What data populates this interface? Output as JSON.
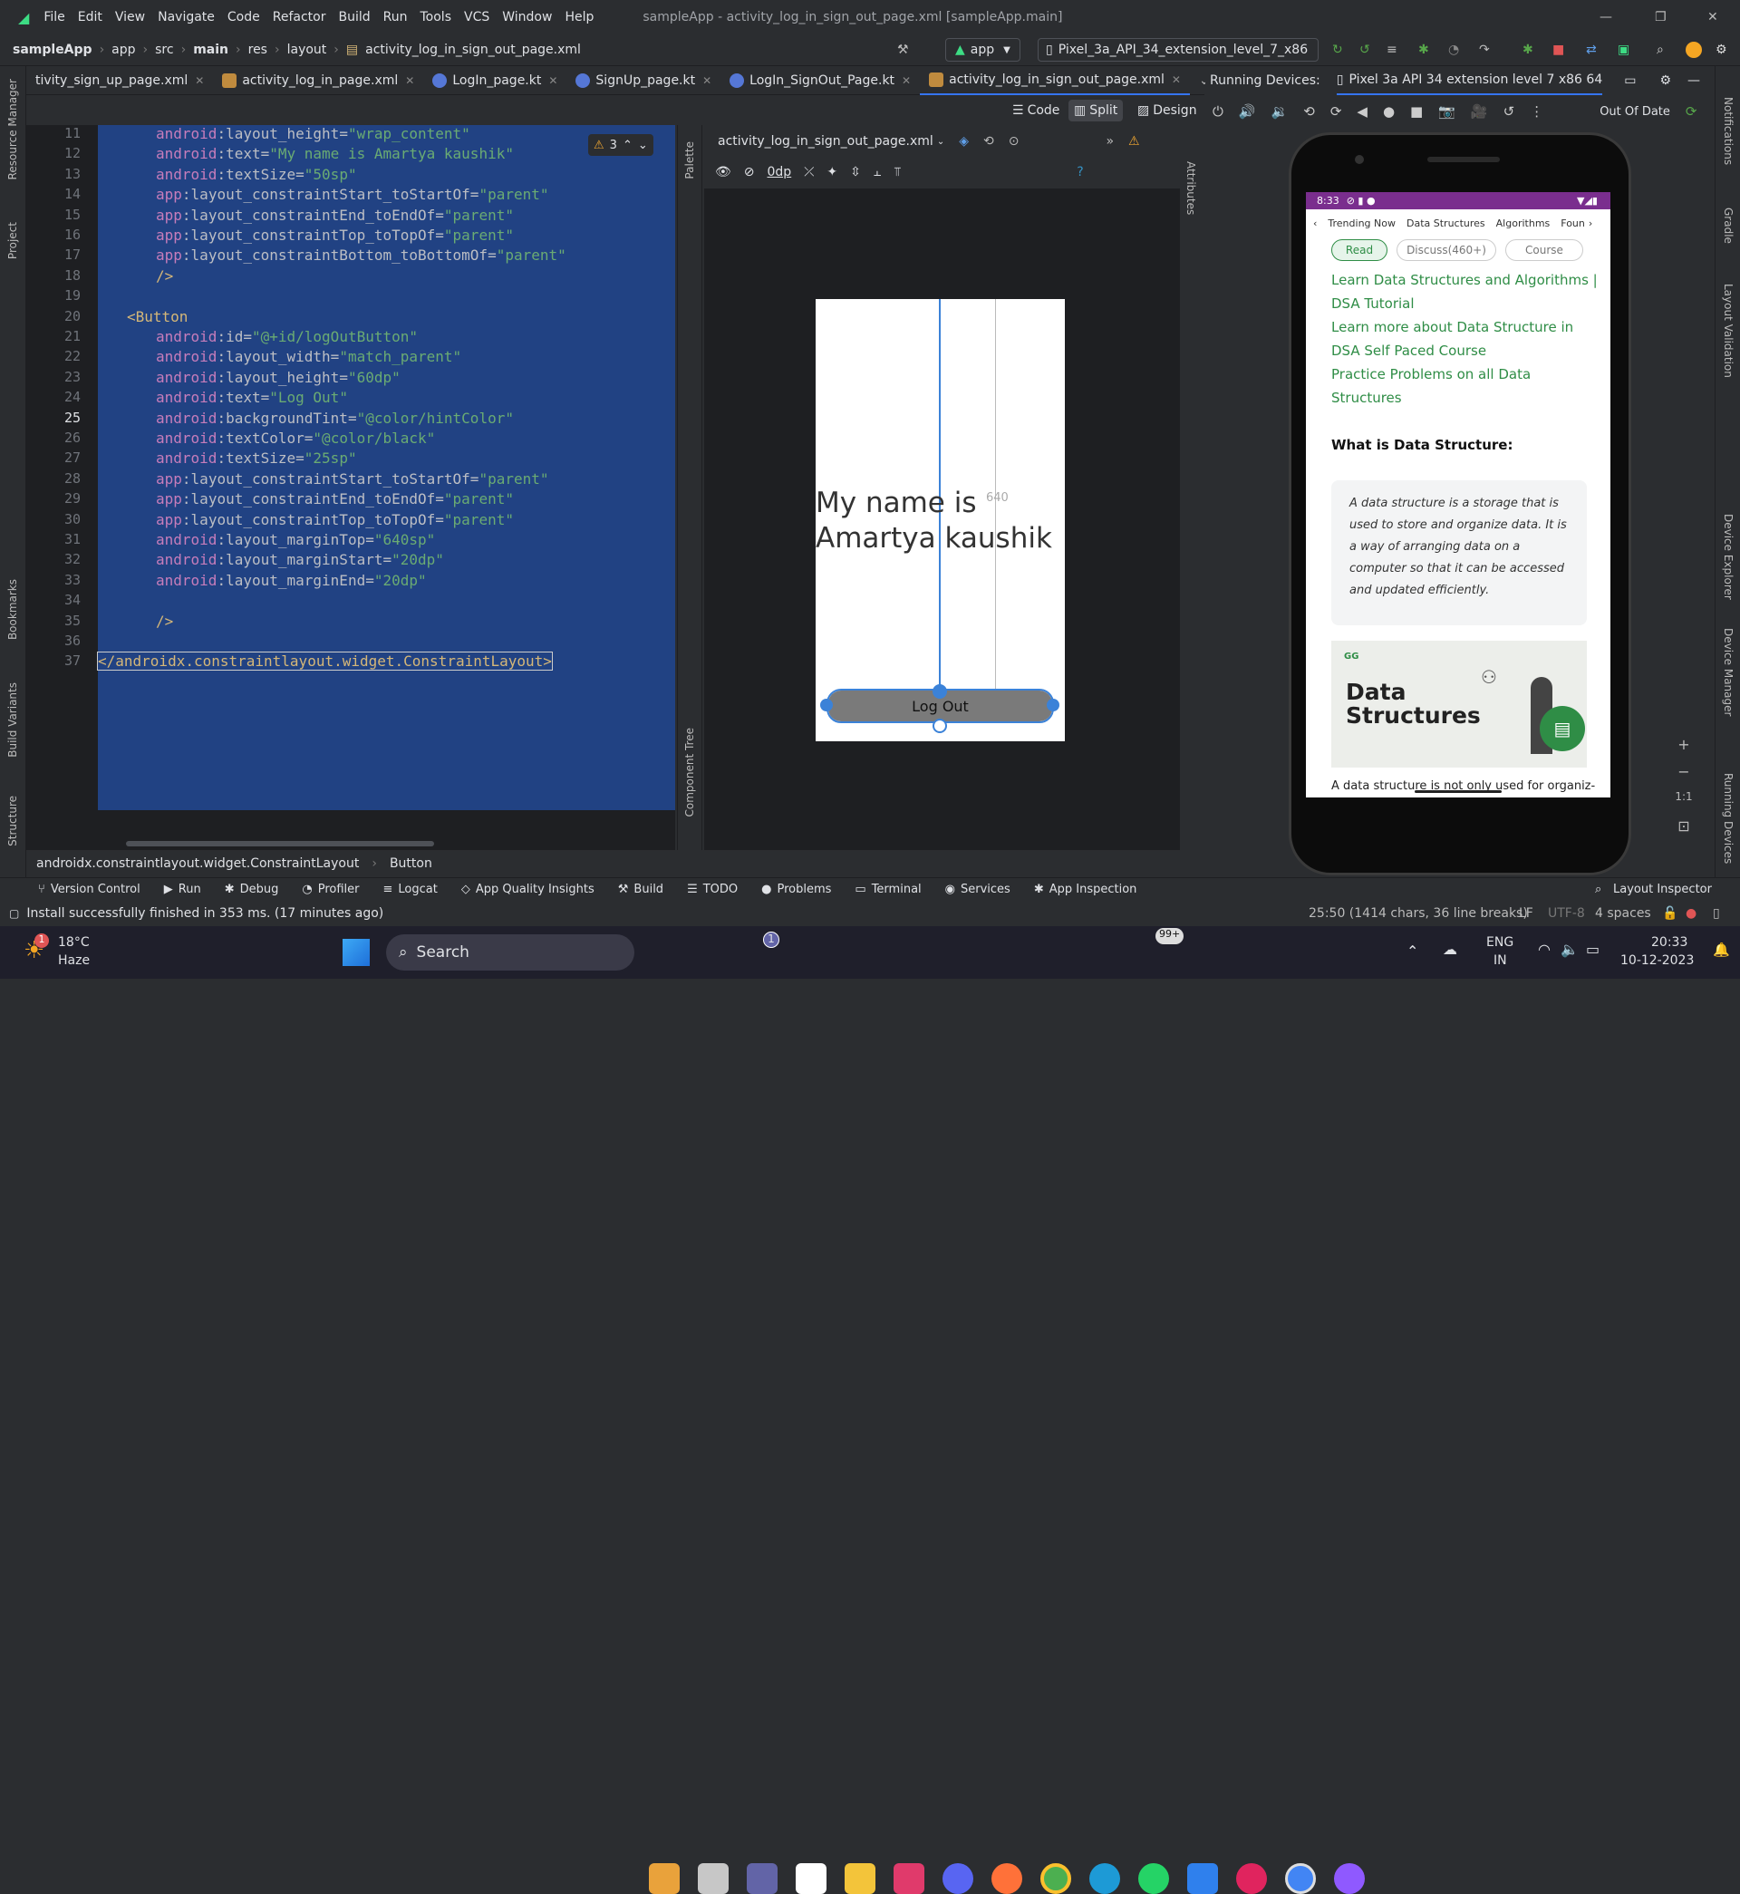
{
  "menu": {
    "items": [
      "File",
      "Edit",
      "View",
      "Navigate",
      "Code",
      "Refactor",
      "Build",
      "Run",
      "Tools",
      "VCS",
      "Window",
      "Help"
    ],
    "window_title": "sampleApp - activity_log_in_sign_out_page.xml [sampleApp.main]"
  },
  "breadcrumb": {
    "items": [
      "sampleApp",
      "app",
      "src",
      "main",
      "res",
      "layout",
      "activity_log_in_sign_out_page.xml"
    ]
  },
  "toolbar": {
    "run_config": "app",
    "device": "Pixel_3a_API_34_extension_level_7_x86"
  },
  "tabs": [
    {
      "label": "tivity_sign_up_page.xml"
    },
    {
      "label": "activity_log_in_page.xml"
    },
    {
      "label": "LogIn_page.kt"
    },
    {
      "label": "SignUp_page.kt"
    },
    {
      "label": "LogIn_SignOut_Page.kt"
    },
    {
      "label": "activity_log_in_sign_out_page.xml"
    }
  ],
  "running_devices": {
    "label": "Running Devices:",
    "device_tab": "Pixel 3a API 34 extension level 7 x86 64",
    "status": "Out Of Date"
  },
  "view_modes": {
    "code": "Code",
    "split": "Split",
    "design": "Design"
  },
  "editor": {
    "warning_count": "3",
    "line_numbers": [
      "11",
      "12",
      "13",
      "14",
      "15",
      "16",
      "17",
      "18",
      "19",
      "20",
      "21",
      "22",
      "23",
      "24",
      "25",
      "26",
      "27",
      "28",
      "29",
      "30",
      "31",
      "32",
      "33",
      "34",
      "35",
      "36",
      "37"
    ],
    "lines": [
      {
        "ns": "android",
        "attr": "layout_height",
        "val": "\"wrap_content\""
      },
      {
        "ns": "android",
        "attr": "text",
        "val": "\"My name is Amartya kaushik\""
      },
      {
        "ns": "android",
        "attr": "textSize",
        "val": "\"50sp\""
      },
      {
        "ns": "app",
        "attr": "layout_constraintStart_toStartOf",
        "val": "\"parent\""
      },
      {
        "ns": "app",
        "attr": "layout_constraintEnd_toEndOf",
        "val": "\"parent\""
      },
      {
        "ns": "app",
        "attr": "layout_constraintTop_toTopOf",
        "val": "\"parent\""
      },
      {
        "ns": "app",
        "attr": "layout_constraintBottom_toBottomOf",
        "val": "\"parent\""
      },
      {
        "tag": "/>"
      },
      {
        "tag": ""
      },
      {
        "tag": "<Button"
      },
      {
        "ns": "android",
        "attr": "id",
        "val": "\"@+id/logOutButton\""
      },
      {
        "ns": "android",
        "attr": "layout_width",
        "val": "\"match_parent\""
      },
      {
        "ns": "android",
        "attr": "layout_height",
        "val": "\"60dp\""
      },
      {
        "ns": "android",
        "attr": "text",
        "val": "\"Log Out\""
      },
      {
        "ns": "android",
        "attr": "backgroundTint",
        "val": "\"@color/hintColor\""
      },
      {
        "ns": "android",
        "attr": "textColor",
        "val": "\"@color/black\""
      },
      {
        "ns": "android",
        "attr": "textSize",
        "val": "\"25sp\""
      },
      {
        "ns": "app",
        "attr": "layout_constraintStart_toStartOf",
        "val": "\"parent\""
      },
      {
        "ns": "app",
        "attr": "layout_constraintEnd_toEndOf",
        "val": "\"parent\""
      },
      {
        "ns": "app",
        "attr": "layout_constraintTop_toTopOf",
        "val": "\"parent\""
      },
      {
        "ns": "android",
        "attr": "layout_marginTop",
        "val": "\"640sp\""
      },
      {
        "ns": "android",
        "attr": "layout_marginStart",
        "val": "\"20dp\""
      },
      {
        "ns": "android",
        "attr": "layout_marginEnd",
        "val": "\"20dp\""
      },
      {
        "tag": ""
      },
      {
        "tag": "/>"
      },
      {
        "tag": ""
      },
      {
        "tag": "</androidx.constraintlayout.widget.ConstraintLayout>"
      }
    ],
    "footer_breadcrumb": [
      "androidx.constraintlayout.widget.ConstraintLayout",
      "Button"
    ]
  },
  "design": {
    "file": "activity_log_in_sign_out_page.xml",
    "margin_value": "0dp",
    "preview_text": "My name is Amartya kaushik",
    "button_label": "Log Out",
    "dimension_label": "640",
    "palette": "Palette",
    "component_tree": "Component Tree",
    "attributes": "Attributes"
  },
  "device_screen": {
    "time": "8:33",
    "nav_tabs": [
      "Trending Now",
      "Data Structures",
      "Algorithms",
      "Foun"
    ],
    "chips": [
      "Read",
      "Discuss(460+)",
      "Course"
    ],
    "links": [
      "Learn Data Structures and Algorithms | DSA Tutorial",
      "Learn more about Data Structure in DSA Self Paced Course",
      "Practice Problems on all Data Structures"
    ],
    "heading": "What is Data Structure:",
    "quote": "A data structure is a storage that is used to store and organize data. It is a way of arranging data on a computer so that it can be accessed and updated efficiently.",
    "banner_logo": "GG",
    "banner_title": "Data Structures",
    "trailing_text": "A data structure is not only used for organiz-"
  },
  "device_zoom": {
    "ratio": "1:1"
  },
  "side_labels": {
    "left": [
      "Resource Manager",
      "Project",
      "Bookmarks",
      "Build Variants",
      "Structure"
    ],
    "right": [
      "Notifications",
      "Gradle",
      "Layout Validation",
      "Device Explorer",
      "Device Manager",
      "Running Devices"
    ]
  },
  "bottom_tools": [
    "Version Control",
    "Run",
    "Debug",
    "Profiler",
    "Logcat",
    "App Quality Insights",
    "Build",
    "TODO",
    "Problems",
    "Terminal",
    "Services",
    "App Inspection"
  ],
  "layout_inspector": "Layout Inspector",
  "status": {
    "message": "Install successfully finished in 353 ms. (17 minutes ago)",
    "position": "25:50 (1414 chars, 36 line breaks)",
    "line_sep": "LF",
    "encoding": "UTF-8",
    "indent": "4 spaces"
  },
  "taskbar": {
    "weather_temp": "18°C",
    "weather_desc": "Haze",
    "weather_badge": "1",
    "search": "Search",
    "whatsapp_badge": "99+",
    "teams_badge": "1",
    "lang": "ENG",
    "region": "IN",
    "time": "20:33",
    "date": "10-12-2023"
  }
}
